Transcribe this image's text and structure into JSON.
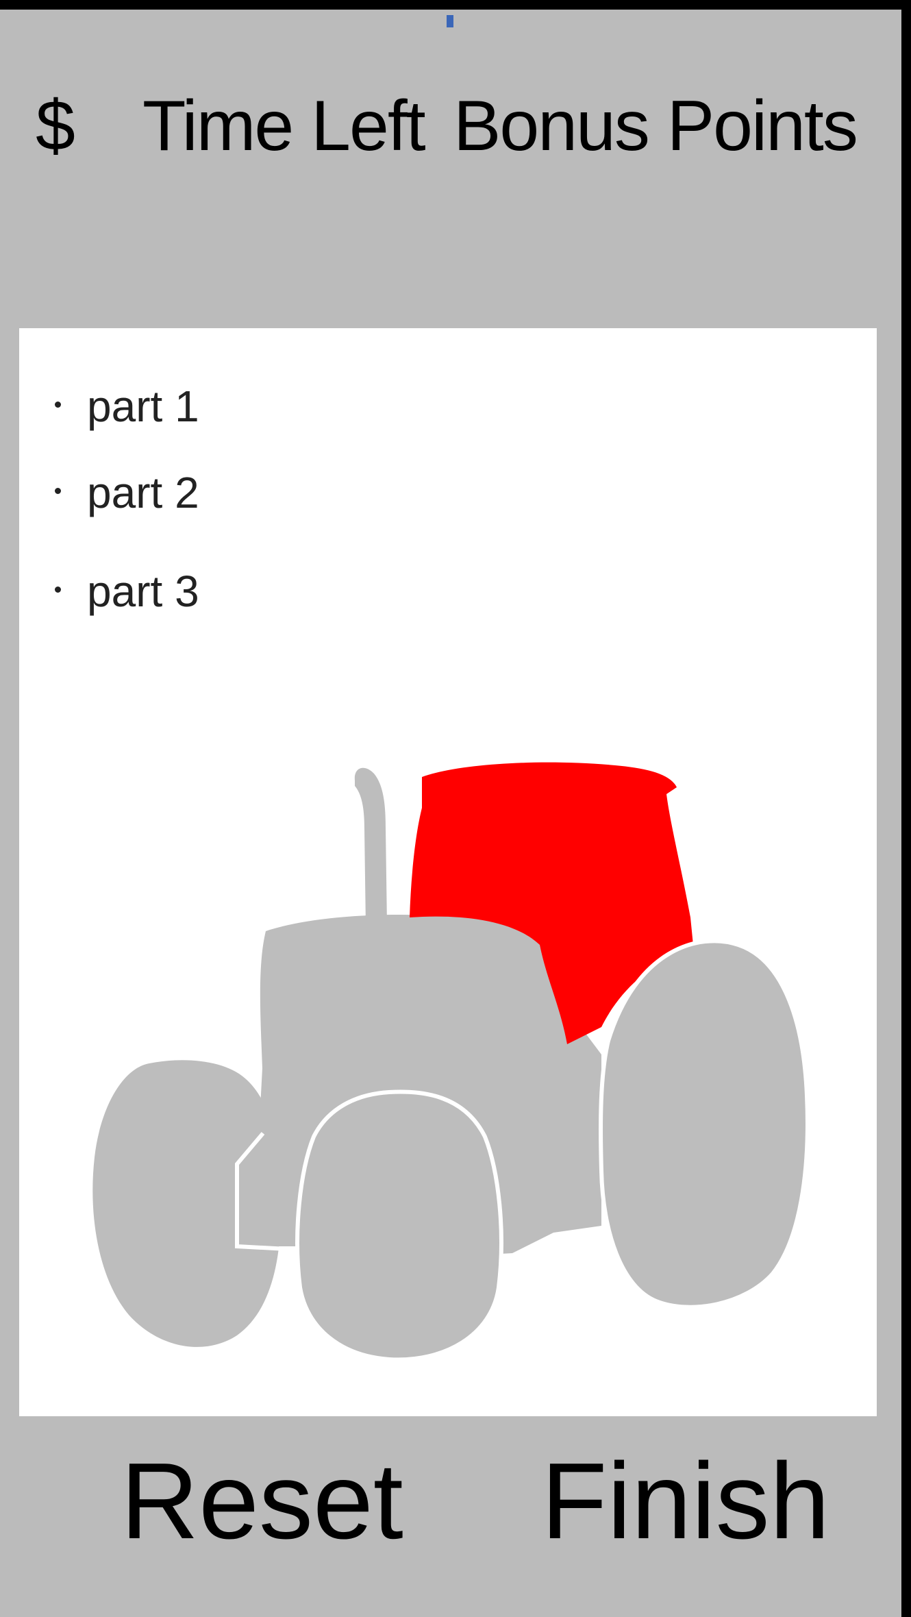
{
  "hud": {
    "currency_symbol": "$",
    "time_label": "Time Left",
    "bonus_label": "Bonus Points"
  },
  "parts": [
    {
      "label": "part 1"
    },
    {
      "label": "part 2"
    },
    {
      "label": "part 3"
    }
  ],
  "tractor": {
    "highlighted_part": "cab",
    "highlight_color": "#ff0000",
    "body_color": "#bdbdbd"
  },
  "actions": {
    "reset_label": "Reset",
    "finish_label": "Finish"
  },
  "colors": {
    "background": "#bbbbbb",
    "panel": "#ffffff",
    "border": "#000000"
  }
}
